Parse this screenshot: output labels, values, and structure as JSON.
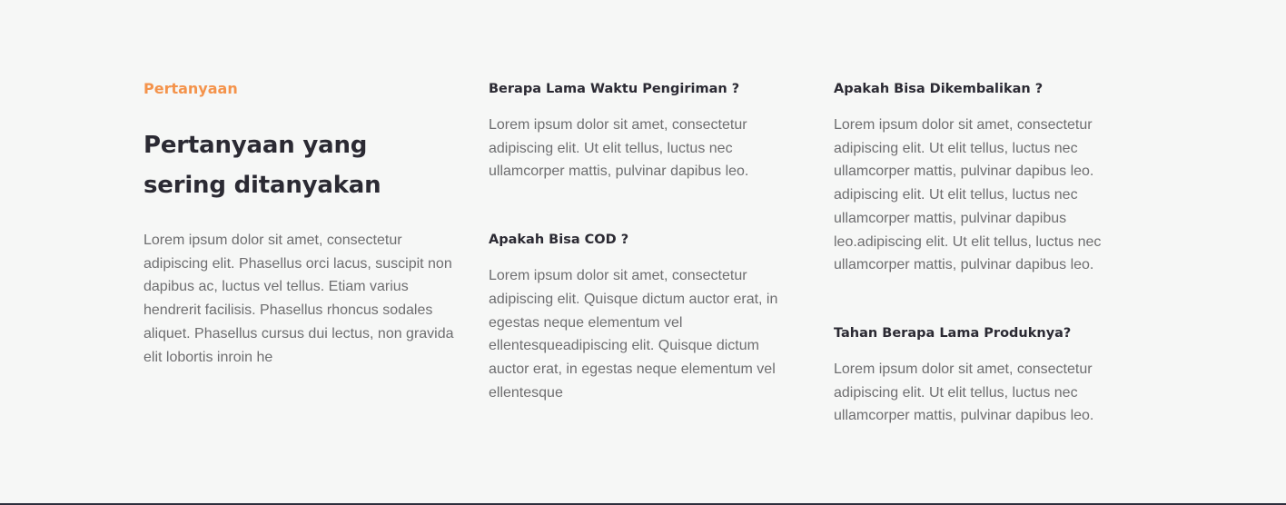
{
  "intro": {
    "eyebrow": "Pertanyaan",
    "heading": "Pertanyaan yang sering ditanyakan",
    "text": "Lorem ipsum dolor sit amet, consectetur adipiscing elit. Phasellus orci lacus, suscipit non dapibus ac, luctus vel tellus. Etiam varius hendrerit facilisis. Phasellus rhoncus sodales aliquet. Phasellus cursus dui lectus, non gravida elit lobortis inroin he"
  },
  "faqs": {
    "col_a": [
      {
        "question": "Berapa Lama Waktu Pengiriman ?",
        "answer": "Lorem ipsum dolor sit amet, consectetur adipiscing elit. Ut elit tellus, luctus nec ullamcorper mattis, pulvinar dapibus leo."
      },
      {
        "question": "Apakah Bisa COD ?",
        "answer": "Lorem ipsum dolor sit amet, consectetur adipiscing elit. Quisque dictum auctor erat, in egestas neque elementum vel ellentesqueadipiscing elit. Quisque dictum auctor erat, in egestas neque elementum vel ellentesque"
      }
    ],
    "col_b": [
      {
        "question": "Apakah Bisa Dikembalikan ?",
        "answer": "Lorem ipsum dolor sit amet, consectetur adipiscing elit. Ut elit tellus, luctus nec ullamcorper mattis, pulvinar dapibus leo. adipiscing elit. Ut elit tellus, luctus nec ullamcorper mattis, pulvinar dapibus leo.adipiscing elit. Ut elit tellus, luctus nec ullamcorper mattis, pulvinar dapibus leo."
      },
      {
        "question": "Tahan Berapa Lama Produknya?",
        "answer": "Lorem ipsum dolor sit amet, consectetur adipiscing elit. Ut elit tellus, luctus nec ullamcorper mattis, pulvinar dapibus leo."
      }
    ]
  },
  "colors": {
    "accent": "#f4934b",
    "heading": "#2b2a33",
    "body_text": "#6e6e70",
    "background": "#f6f7f6"
  }
}
